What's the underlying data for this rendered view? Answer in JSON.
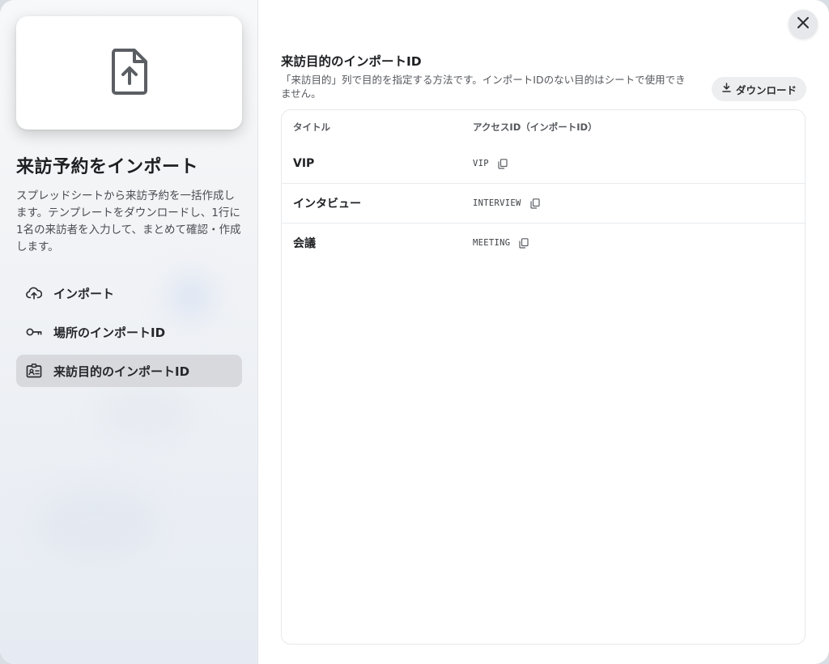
{
  "sidebar": {
    "title": "来訪予約をインポート",
    "description": "スプレッドシートから来訪予約を一括作成します。テンプレートをダウンロードし、1行に1名の来訪者を入力して、まとめて確認・作成します。",
    "preview_icon": "file-upload-icon",
    "items": [
      {
        "label": "インポート",
        "icon": "cloud-upload-icon",
        "active": false
      },
      {
        "label": "場所のインポートID",
        "icon": "key-icon",
        "active": false
      },
      {
        "label": "来訪目的のインポートID",
        "icon": "id-card-icon",
        "active": true
      }
    ]
  },
  "main": {
    "title": "来訪目的のインポートID",
    "description": "「来訪目的」列で目的を指定する方法です。インポートIDのない目的はシートで使用できません。",
    "download_label": "ダウンロード",
    "table": {
      "headers": {
        "title": "タイトル",
        "id": "アクセスID（インポートID）"
      },
      "rows": [
        {
          "title": "VIP",
          "id": "VIP"
        },
        {
          "title": "インタビュー",
          "id": "INTERVIEW"
        },
        {
          "title": "会議",
          "id": "MEETING"
        }
      ]
    }
  },
  "colors": {
    "active_nav_bg": "#d8d9dc",
    "text_primary": "#1e1f22",
    "button_bg": "#eceef0"
  }
}
